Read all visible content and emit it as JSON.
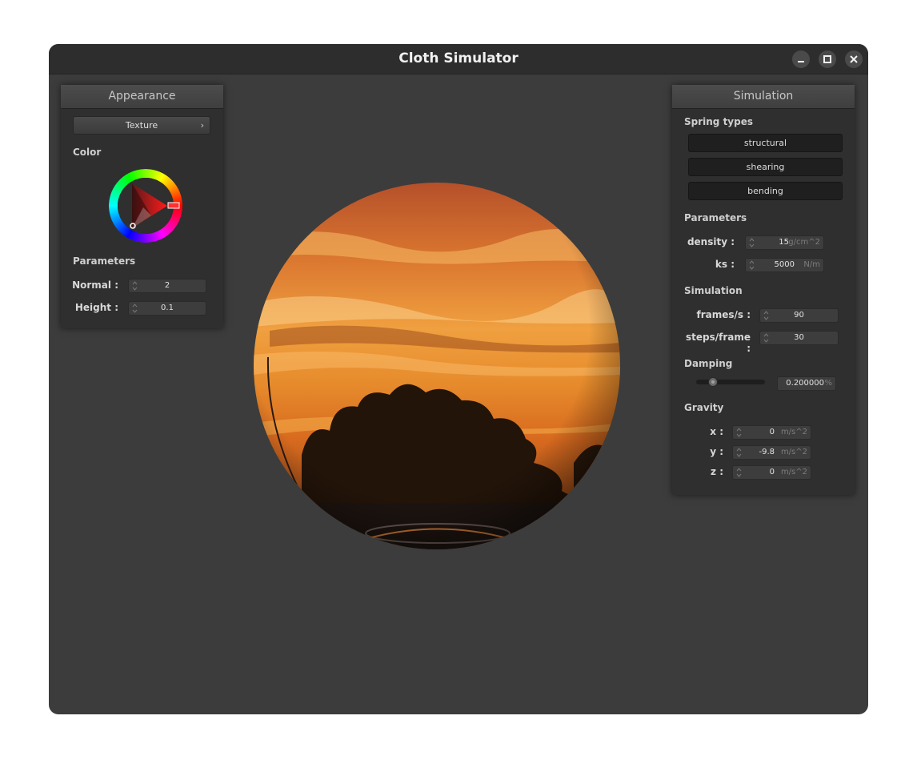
{
  "window": {
    "title": "Cloth Simulator"
  },
  "appearance": {
    "header": "Appearance",
    "texture_button": "Texture",
    "color_label": "Color",
    "parameters_label": "Parameters",
    "normal": {
      "label": "Normal :",
      "value": "2"
    },
    "height": {
      "label": "Height :",
      "value": "0.1"
    }
  },
  "simulation": {
    "header": "Simulation",
    "spring_types_label": "Spring types",
    "spring_types": [
      "structural",
      "shearing",
      "bending"
    ],
    "parameters_label": "Parameters",
    "density": {
      "label": "density :",
      "value": "15",
      "unit": "g/cm^2"
    },
    "ks": {
      "label": "ks :",
      "value": "5000",
      "unit": "N/m"
    },
    "simulation_label": "Simulation",
    "frames": {
      "label": "frames/s :",
      "value": "90"
    },
    "steps": {
      "label": "steps/frame :",
      "value": "30"
    },
    "damping_label": "Damping",
    "damping": {
      "value": "0.200000",
      "unit": "%",
      "slider_fraction": 0.2
    },
    "gravity_label": "Gravity",
    "gravity_x": {
      "label": "x :",
      "value": "0",
      "unit": "m/s^2"
    },
    "gravity_y": {
      "label": "y :",
      "value": "-9.8",
      "unit": "m/s^2"
    },
    "gravity_z": {
      "label": "z :",
      "value": "0",
      "unit": "m/s^2"
    }
  },
  "colors": {
    "window_bg": "#3c3c3c",
    "panel_bg": "#2f2f2f",
    "selected_color": "#ff2a2a"
  },
  "icons": [
    "minimize-icon",
    "maximize-icon",
    "close-icon",
    "chevron-right-icon",
    "spin-arrows-icon"
  ]
}
